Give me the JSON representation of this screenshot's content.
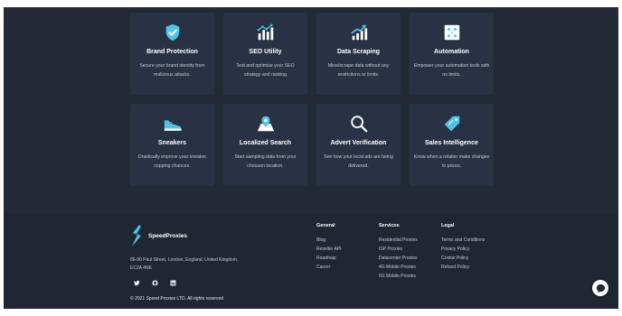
{
  "colors": {
    "background": "#222a36",
    "card": "#283244",
    "footer": "#1f2732",
    "accent": "#4fc3e8"
  },
  "features": [
    {
      "icon": "shield-check-icon",
      "title": "Brand Protection",
      "desc": "Secure your brand identity from malicious attacks."
    },
    {
      "icon": "bar-chart-icon",
      "title": "SEO Utility",
      "desc": "Test and optimise your SEO strategy and ranking"
    },
    {
      "icon": "trend-up-icon",
      "title": "Data Scraping",
      "desc": "Mine/scrape data without any restrictions or limits."
    },
    {
      "icon": "automation-icon",
      "title": "Automation",
      "desc": "Empower your automation tools with no limits."
    },
    {
      "icon": "sneaker-icon",
      "title": "Sneakers",
      "desc": "Drastically improve your sneaker copping chances."
    },
    {
      "icon": "map-pin-icon",
      "title": "Localized Search",
      "desc": "Start sampling data from your choosen location."
    },
    {
      "icon": "magnifier-icon",
      "title": "Advert Verification",
      "desc": "See how your local ads are being delivered."
    },
    {
      "icon": "price-tag-icon",
      "title": "Sales Intelligence",
      "desc": "Know when a retailer make changes to prices."
    }
  ],
  "footer": {
    "brand": "SpeedProxies",
    "address": "86-90 Paul Street, London, England, United Kingdom, EC2A 4NE",
    "copyright": "© 2021 Speed Proxies LTD. All rights reserved",
    "socials": [
      "twitter-icon",
      "github-icon",
      "linkedin-icon"
    ],
    "columns": [
      {
        "heading": "General",
        "links": [
          "Blog",
          "Reseller API",
          "Roadmap",
          "Career"
        ]
      },
      {
        "heading": "Services",
        "links": [
          "Residential Proxies",
          "ISP Proxies",
          "Datacenter Proxies",
          "4G Mobile Proxies",
          "5G Mobile Proxies"
        ]
      },
      {
        "heading": "Legal",
        "links": [
          "Terms and Conditions",
          "Privacy Policy",
          "Cookie Policy",
          "Refund Policy"
        ]
      }
    ]
  },
  "chat": {
    "icon": "chat-bubble-icon"
  }
}
